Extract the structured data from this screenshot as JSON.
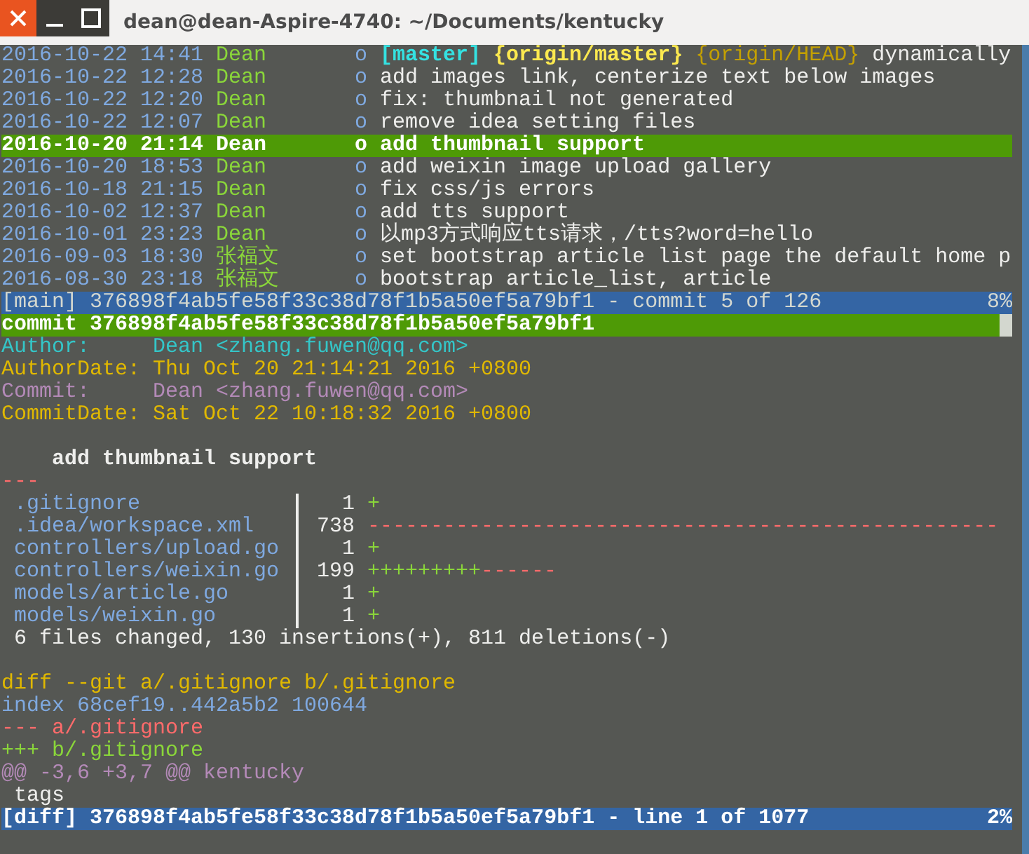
{
  "window": {
    "title": "dean@dean-Aspire-4740: ~/Documents/kentucky"
  },
  "log": {
    "rows": [
      {
        "date": "2016-10-22 14:41",
        "author": "Dean",
        "graph": "o",
        "refs": [
          {
            "text": "[master]",
            "kind": "local"
          },
          {
            "text": "{origin/master}",
            "kind": "remote"
          },
          {
            "text": "{origin/HEAD}",
            "kind": "head"
          }
        ],
        "message": "dynamically",
        "selected": false
      },
      {
        "date": "2016-10-22 12:28",
        "author": "Dean",
        "graph": "o",
        "message": "add images link, centerize text below images",
        "selected": false
      },
      {
        "date": "2016-10-22 12:20",
        "author": "Dean",
        "graph": "o",
        "message": "fix: thumbnail not generated",
        "selected": false
      },
      {
        "date": "2016-10-22 12:07",
        "author": "Dean",
        "graph": "o",
        "message": "remove idea setting files",
        "selected": false
      },
      {
        "date": "2016-10-20 21:14",
        "author": "Dean",
        "graph": "o",
        "message": "add thumbnail support",
        "selected": true
      },
      {
        "date": "2016-10-20 18:53",
        "author": "Dean",
        "graph": "o",
        "message": "add weixin image upload gallery",
        "selected": false
      },
      {
        "date": "2016-10-18 21:15",
        "author": "Dean",
        "graph": "o",
        "message": "fix css/js errors",
        "selected": false
      },
      {
        "date": "2016-10-02 12:37",
        "author": "Dean",
        "graph": "o",
        "message": "add tts support",
        "selected": false
      },
      {
        "date": "2016-10-01 23:23",
        "author": "Dean",
        "graph": "o",
        "message": "以mp3方式响应tts请求，/tts?word=hello",
        "selected": false
      },
      {
        "date": "2016-09-03 18:30",
        "author": "张福文",
        "graph": "o",
        "message": "set bootstrap article list page the default home p",
        "selected": false
      },
      {
        "date": "2016-08-30 23:18",
        "author": "张福文",
        "graph": "o",
        "message": "bootstrap article_list, article",
        "selected": false
      }
    ],
    "status": {
      "view": "[main]",
      "text": "376898f4ab5fe58f33c38d78f1b5a50ef5a79bf1 - commit 5 of 126",
      "percent": "8%",
      "active": false
    }
  },
  "diff": {
    "lines": [
      {
        "kind": "commit",
        "text": "commit 376898f4ab5fe58f33c38d78f1b5a50ef5a79bf1"
      },
      {
        "kind": "author",
        "text": "Author:     Dean <zhang.fuwen@qq.com>"
      },
      {
        "kind": "authordate",
        "text": "AuthorDate: Thu Oct 20 21:14:21 2016 +0800"
      },
      {
        "kind": "committer",
        "text": "Commit:     Dean <zhang.fuwen@qq.com>"
      },
      {
        "kind": "commitdate",
        "text": "CommitDate: Sat Oct 22 10:18:32 2016 +0800"
      },
      {
        "kind": "blank"
      },
      {
        "kind": "message",
        "text": "add thumbnail support"
      },
      {
        "kind": "separator",
        "text": "---"
      },
      {
        "kind": "stat",
        "file": ".gitignore",
        "count": "1",
        "added": "+"
      },
      {
        "kind": "stat",
        "file": ".idea/workspace.xml",
        "count": "738",
        "removed": "--------------------------------------------------"
      },
      {
        "kind": "stat",
        "file": "controllers/upload.go",
        "count": "1",
        "added": "+"
      },
      {
        "kind": "stat",
        "file": "controllers/weixin.go",
        "count": "199",
        "added": "+++++++++",
        "removed": "------"
      },
      {
        "kind": "stat",
        "file": "models/article.go",
        "count": "1",
        "added": "+"
      },
      {
        "kind": "stat",
        "file": "models/weixin.go",
        "count": "1",
        "added": "+"
      },
      {
        "kind": "summary",
        "text": "6 files changed, 130 insertions(+), 811 deletions(-)"
      },
      {
        "kind": "blank"
      },
      {
        "kind": "diff",
        "text": "diff --git a/.gitignore b/.gitignore"
      },
      {
        "kind": "index",
        "text": "index 68cef19..442a5b2 100644"
      },
      {
        "kind": "old_file",
        "text": "--- a/.gitignore"
      },
      {
        "kind": "new_file",
        "text": "+++ b/.gitignore"
      },
      {
        "kind": "hunk",
        "text": "@@ -3,6 +3,7 @@ kentucky"
      },
      {
        "kind": "context",
        "text": " tags"
      }
    ],
    "status": {
      "view": "[diff]",
      "text": "376898f4ab5fe58f33c38d78f1b5a50ef5a79bf1 - line 1 of 1077",
      "percent": "2%",
      "active": true
    }
  }
}
